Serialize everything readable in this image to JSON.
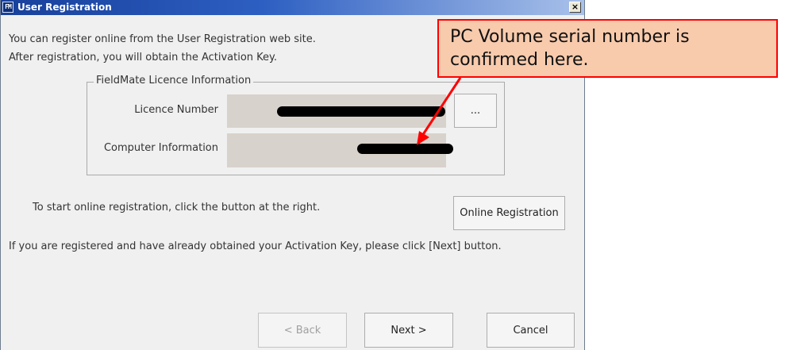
{
  "window": {
    "app_icon_text": "FM",
    "title": "User Registration",
    "close_glyph": "×"
  },
  "intro": {
    "line1": "You can register online from the User Registration web site.",
    "line2": "After registration, you will obtain the Activation Key."
  },
  "licence_group": {
    "legend": "FieldMate Licence Information",
    "licence_number_label": "Licence Number",
    "licence_number_value": "[redacted]",
    "computer_info_label": "Computer Information",
    "computer_info_value": "[redacted]",
    "browse_button_label": "..."
  },
  "online": {
    "instruction": "To start online registration, click the button at the right.",
    "button_label": "Online Registration"
  },
  "next_instruction": "If you are registered and have already obtained your Activation Key, please click [Next] button.",
  "footer": {
    "back_label": "< Back",
    "next_label": "Next >",
    "cancel_label": "Cancel"
  },
  "callout": {
    "line1": "PC Volume serial number is",
    "line2": "confirmed here."
  },
  "colors": {
    "callout_fill": "#f8cbad",
    "callout_border": "#ff0000",
    "arrow": "#ff0000",
    "field_background": "#d8d2cc"
  }
}
